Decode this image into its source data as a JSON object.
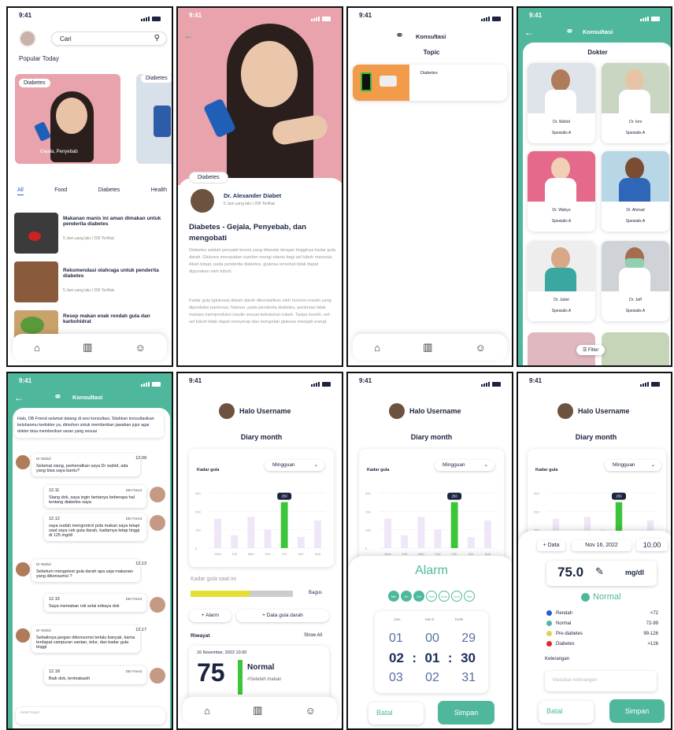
{
  "status": {
    "time": "9:41"
  },
  "s1": {
    "search_placeholder": "Cari",
    "popular": "Popular Today",
    "card1_tag": "Diabetes",
    "card1_caption": "Gejala, Penyebab",
    "card2_tag": "Diabetes",
    "tabs": [
      "All",
      "Food",
      "Diabetes",
      "Health"
    ],
    "articles": [
      {
        "title": "Makanan manis ini aman dimakan untuk penderita diabetes",
        "meta": "5 Jam yang lalu I 200 Terlihat"
      },
      {
        "title": "Rekomendasi olahraga untuk penderita diabetes",
        "meta": "5 Jam yang lalu I 200 Terlihat"
      },
      {
        "title": "Resep makan enak rendah gula dan karbohidrat",
        "meta": ""
      }
    ]
  },
  "s2": {
    "tag": "Diabetes",
    "author": "Dr. Alexander Diabet",
    "meta": "5 Jam yang lalu I 200 Terlihat",
    "title": "Diabetes - Gejala, Penyebab, dan mengobati",
    "p1": "Diabetes adalah penyakit kronis yang ditandai dengan tingginya kadar gula darah. Glukosa merupakan sumber energi utama bagi sel tubuh manusia. Akan tetapi, pada penderita diabetes, glukosa tersebut tidak dapat digunakan oleh tubuh.",
    "p2": "Kadar gula (glukosa) dalam darah dikendalikan oleh hormon insulin yang diproduksi pankreas. Namun, pada penderita diabetes, pankreas tidak mampu memproduksi insulin sesuai kebutuhan tubuh. Tanpa insulin, sel-sel tubuh tidak dapat menyerap dan mengolah glukosa menjadi energi."
  },
  "s3": {
    "title": "Konsultasi",
    "topic": "Topic",
    "item": "Diabetes"
  },
  "s4": {
    "title": "Konsultasi",
    "doctor": "Dokter",
    "filter": "Filter",
    "doctors": [
      {
        "name": "Dr. Wahid",
        "spec": "Spesialis A"
      },
      {
        "name": "Dr. Ioni",
        "spec": "Spesialis A"
      },
      {
        "name": "Dr. Wahyu",
        "spec": "Spesialis A"
      },
      {
        "name": "Dr. Ahmad",
        "spec": "Spesialis A"
      },
      {
        "name": "Dr. Juliet",
        "spec": "Spesialis A"
      },
      {
        "name": "Dr. Jeff",
        "spec": "Spesialis A"
      }
    ]
  },
  "s5": {
    "title": "Konsultasi",
    "intro": "Halo, DB Friend selamat datang di sesi konsultasi. Silahkan konsultasikan keluhanmu kedokter ya, dimohon untuk memberikan jawaban jujur agar dokter bisa memberikan saran yang sesuai",
    "msgs": [
      {
        "who": "Dr Wahid",
        "time": "12.09",
        "text": "Selamat siang, perkenalkan saya Dr wahid, ada yang bisa saya bantu?"
      },
      {
        "who": "DB Friend",
        "time": "12.11",
        "text": "Siang dok, saya ingin bertanya beberapa hal tentang diabetes saya"
      },
      {
        "who": "DB Friend",
        "time": "12.12",
        "text": "saya sudah mengontrol pola makan saya tetapi saat saya cek gula darah, kadarnya tetap tinggi di 125 mg/dl"
      },
      {
        "who": "Dr Wahid",
        "time": "12.13",
        "text": "Sebelum mengetest gula darah apa saja makanan yang dikonsumsi ?"
      },
      {
        "who": "DB Friend",
        "time": "12.15",
        "text": "Saya memakan roti selai srikaya dok"
      },
      {
        "who": "Dr Wahid",
        "time": "12.17",
        "text": "Sebaiknya jangan dikonsumsi terlalu banyak, karna terdapat campuran santan, telur, dan kadar gula tinggi"
      },
      {
        "who": "DB Friend",
        "time": "12.18",
        "text": "Baik dok, terimakasih"
      }
    ],
    "input_placeholder": "Ketik Pesan"
  },
  "diary": {
    "greeting": "Halo Username",
    "title": "Diary month",
    "chart_label": "Kadar gula",
    "period": "Mingguan",
    "today_label": "Kadar gula saat ini",
    "status": "Bagus",
    "add_alarm": "+ Alarm",
    "add_data": "+ Data gula darah",
    "history": "Riwayat",
    "show_all": "Show All",
    "hist_date": "16 November, 2022 10.00",
    "hist_value": "75",
    "hist_status": "Normal",
    "hist_note": "#Setelah makan"
  },
  "chart_data": {
    "type": "bar",
    "categories": [
      "MON",
      "TUE",
      "WED",
      "THU",
      "FRI",
      "SAT",
      "SUN"
    ],
    "values": [
      160,
      70,
      170,
      100,
      250,
      60,
      150
    ],
    "highlight": "FRI",
    "highlight_label": "250",
    "yticks": [
      "300",
      "200",
      "100",
      "0"
    ],
    "ylim": [
      0,
      300
    ]
  },
  "alarm": {
    "title": "Alarm",
    "days": [
      "Min",
      "Sn",
      "Sel",
      "Rab",
      "Kam",
      "Jum",
      "Sab"
    ],
    "active_days": [
      0,
      1,
      2
    ],
    "col_labels": [
      "Jam",
      "Menit",
      "Detik"
    ],
    "rows": [
      [
        "01",
        "00",
        "29"
      ],
      [
        "02",
        "01",
        "30"
      ],
      [
        "03",
        "02",
        "31"
      ]
    ],
    "cancel": "Batal",
    "save": "Simpan"
  },
  "entry": {
    "add": "+ Data",
    "date": "Nov 16, 2022",
    "time": "10.00",
    "value": "75.0",
    "unit": "mg/dl",
    "status": "Normal",
    "legend": [
      {
        "label": "Rendah",
        "range": "<72",
        "color": "#2a5bd7"
      },
      {
        "label": "Normal",
        "range": "72-99",
        "color": "#4fb89c"
      },
      {
        "label": "Pre-diabetes",
        "range": "99-126",
        "color": "#d9d55a"
      },
      {
        "label": "Diabetes",
        "range": ">126",
        "color": "#e0262b"
      }
    ],
    "note_label": "Keterangan",
    "note_placeholder": "Masukan keterangan",
    "cancel": "Batal",
    "save": "Simpan"
  }
}
